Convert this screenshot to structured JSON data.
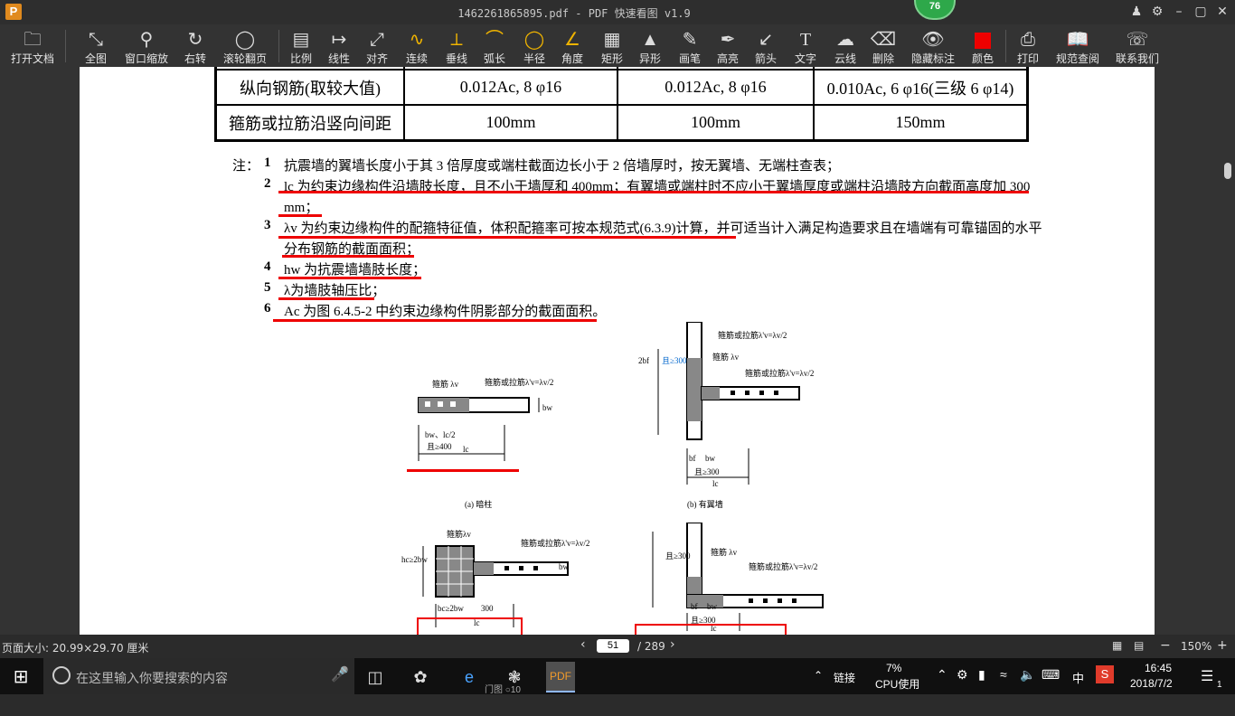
{
  "window": {
    "title": "1462261865895.pdf - PDF 快速看图 v1.9",
    "badge": "76",
    "logo": "P"
  },
  "toolbar": [
    {
      "label": "打开文档",
      "icon": "folder-icon"
    },
    {
      "label": "全图",
      "icon": "fit-all-icon"
    },
    {
      "label": "窗口缩放",
      "icon": "zoom-window-icon"
    },
    {
      "label": "右转",
      "icon": "rotate-right-icon"
    },
    {
      "label": "滚轮翻页",
      "icon": "mouse-scroll-icon"
    },
    {
      "label": "比例",
      "icon": "scale-icon"
    },
    {
      "label": "线性",
      "icon": "linear-dim-icon"
    },
    {
      "label": "对齐",
      "icon": "aligned-dim-icon"
    },
    {
      "label": "连续",
      "icon": "continuous-dim-icon"
    },
    {
      "label": "垂线",
      "icon": "perpendicular-icon"
    },
    {
      "label": "弧长",
      "icon": "arc-length-icon"
    },
    {
      "label": "半径",
      "icon": "radius-icon"
    },
    {
      "label": "角度",
      "icon": "angle-icon"
    },
    {
      "label": "矩形",
      "icon": "rectangle-icon"
    },
    {
      "label": "异形",
      "icon": "polygon-area-icon"
    },
    {
      "label": "画笔",
      "icon": "pen-icon"
    },
    {
      "label": "高亮",
      "icon": "highlighter-icon"
    },
    {
      "label": "箭头",
      "icon": "arrow-icon"
    },
    {
      "label": "文字",
      "icon": "text-icon"
    },
    {
      "label": "云线",
      "icon": "cloud-icon"
    },
    {
      "label": "删除",
      "icon": "eraser-icon"
    },
    {
      "label": "隐藏标注",
      "icon": "eye-hide-icon"
    },
    {
      "label": "颜色",
      "icon": "color-swatch-icon"
    },
    {
      "label": "打印",
      "icon": "print-icon"
    },
    {
      "label": "规范查阅",
      "icon": "book-icon"
    },
    {
      "label": "联系我们",
      "icon": "support-icon"
    }
  ],
  "accent_red": "#e00000",
  "doc": {
    "table_rows": [
      {
        "label": "纵向钢筋(取较大值)",
        "c1": "0.012Ac,  8 φ16",
        "c2": "0.012Ac,  8 φ16",
        "c3": "0.010Ac, 6 φ16(三级 6 φ14)"
      },
      {
        "label": "箍筋或拉筋沿竖向间距",
        "c1": "100mm",
        "c2": "100mm",
        "c3": "150mm"
      }
    ],
    "notes_title": "注：",
    "notes": [
      {
        "num": "1",
        "line1": "抗震墙的翼墙长度小于其 3 倍厚度或端柱截面边长小于 2 倍墙厚时，按无翼墙、无端柱查表；",
        "line2": ""
      },
      {
        "num": "2",
        "line1": "lc 为约束边缘构件沿墙肢长度，且不小于墙厚和 400mm；有翼墙或端柱时不应小于翼墙厚度或端柱沿墙肢方向截面高度加 300",
        "line2": "mm；"
      },
      {
        "num": "3",
        "line1": "λv 为约束边缘构件的配箍特征值，体积配箍率可按本规范式(6.3.9)计算，并可适当计入满足构造要求且在墙端有可靠锚固的水平",
        "line2": "分布钢筋的截面面积；"
      },
      {
        "num": "4",
        "line1": "hw 为抗震墙墙肢长度；",
        "line2": ""
      },
      {
        "num": "5",
        "line1": "λ为墙肢轴压比；",
        "line2": ""
      },
      {
        "num": "6",
        "line1": "Ac 为图 6.4.5-2 中约束边缘构件阴影部分的截面面积。",
        "line2": ""
      }
    ],
    "fig_a": {
      "caption": "(a) 暗柱",
      "label1": "箍筋 λv",
      "label2": "箍筋或拉筋λ'v=λv/2",
      "dim1": "bw、lc/2",
      "dim2": "且≥400",
      "dim3": "lc",
      "dim4": "bw"
    },
    "fig_b": {
      "caption": "(b) 有翼墙",
      "label1": "箍筋或拉筋λ'v=λv/2",
      "label2": "箍筋 λv",
      "label3": "箍筋或拉筋λ'v=λv/2",
      "dim1": "bf",
      "dim2": "bw",
      "dim3": "且≥300",
      "dim4": "lc",
      "dim5": "2bf",
      "dim6": "且≥300"
    },
    "fig_c": {
      "label1": "箍筋λv",
      "label2": "箍筋或拉筋λ'v=λv/2",
      "dim1": "bc≥2bw",
      "dim2": "300",
      "dim3": "lc",
      "dim4": "hc≥2bw",
      "dim5": "bw"
    },
    "fig_d": {
      "label1": "箍筋 λv",
      "label2": "箍筋或拉筋λ'v=λv/2",
      "dim1": "bf",
      "dim2": "bw",
      "dim3": "且≥300",
      "dim4": "lc",
      "dim5": "且≥300"
    }
  },
  "status": {
    "page_size": "页面大小: 20.99×29.70 厘米",
    "page_current": "51",
    "page_total": "/ 289",
    "zoom": "150%",
    "zoom_minus": "−",
    "zoom_plus": "+"
  },
  "taskbar": {
    "search_placeholder": "在这里输入你要搜索的内容",
    "task_label": "门图 ○10",
    "link_label": "链接",
    "cpu_percent": "7%",
    "cpu_label": "CPU使用",
    "ime": "中",
    "time": "16:45",
    "date": "2018/7/2",
    "notif_count": "1"
  }
}
